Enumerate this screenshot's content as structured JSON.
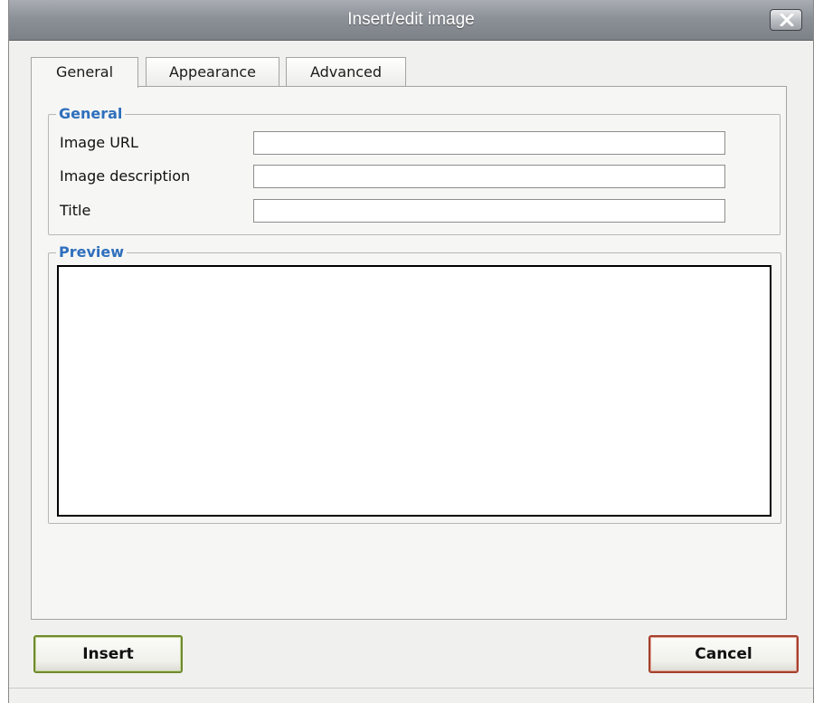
{
  "window": {
    "title": "Insert/edit image",
    "close_icon": "close-icon"
  },
  "tabs": [
    {
      "label": "General",
      "active": true
    },
    {
      "label": "Appearance",
      "active": false
    },
    {
      "label": "Advanced",
      "active": false
    }
  ],
  "general_section": {
    "legend": "General",
    "fields": {
      "image_url": {
        "label": "Image URL",
        "value": ""
      },
      "image_description": {
        "label": "Image description",
        "value": ""
      },
      "title": {
        "label": "Title",
        "value": ""
      }
    }
  },
  "preview_section": {
    "legend": "Preview"
  },
  "buttons": {
    "insert": "Insert",
    "cancel": "Cancel"
  },
  "colors": {
    "legend": "#2f6fbd",
    "insert_border": "#6f8a2c",
    "cancel_border": "#a5412f"
  }
}
